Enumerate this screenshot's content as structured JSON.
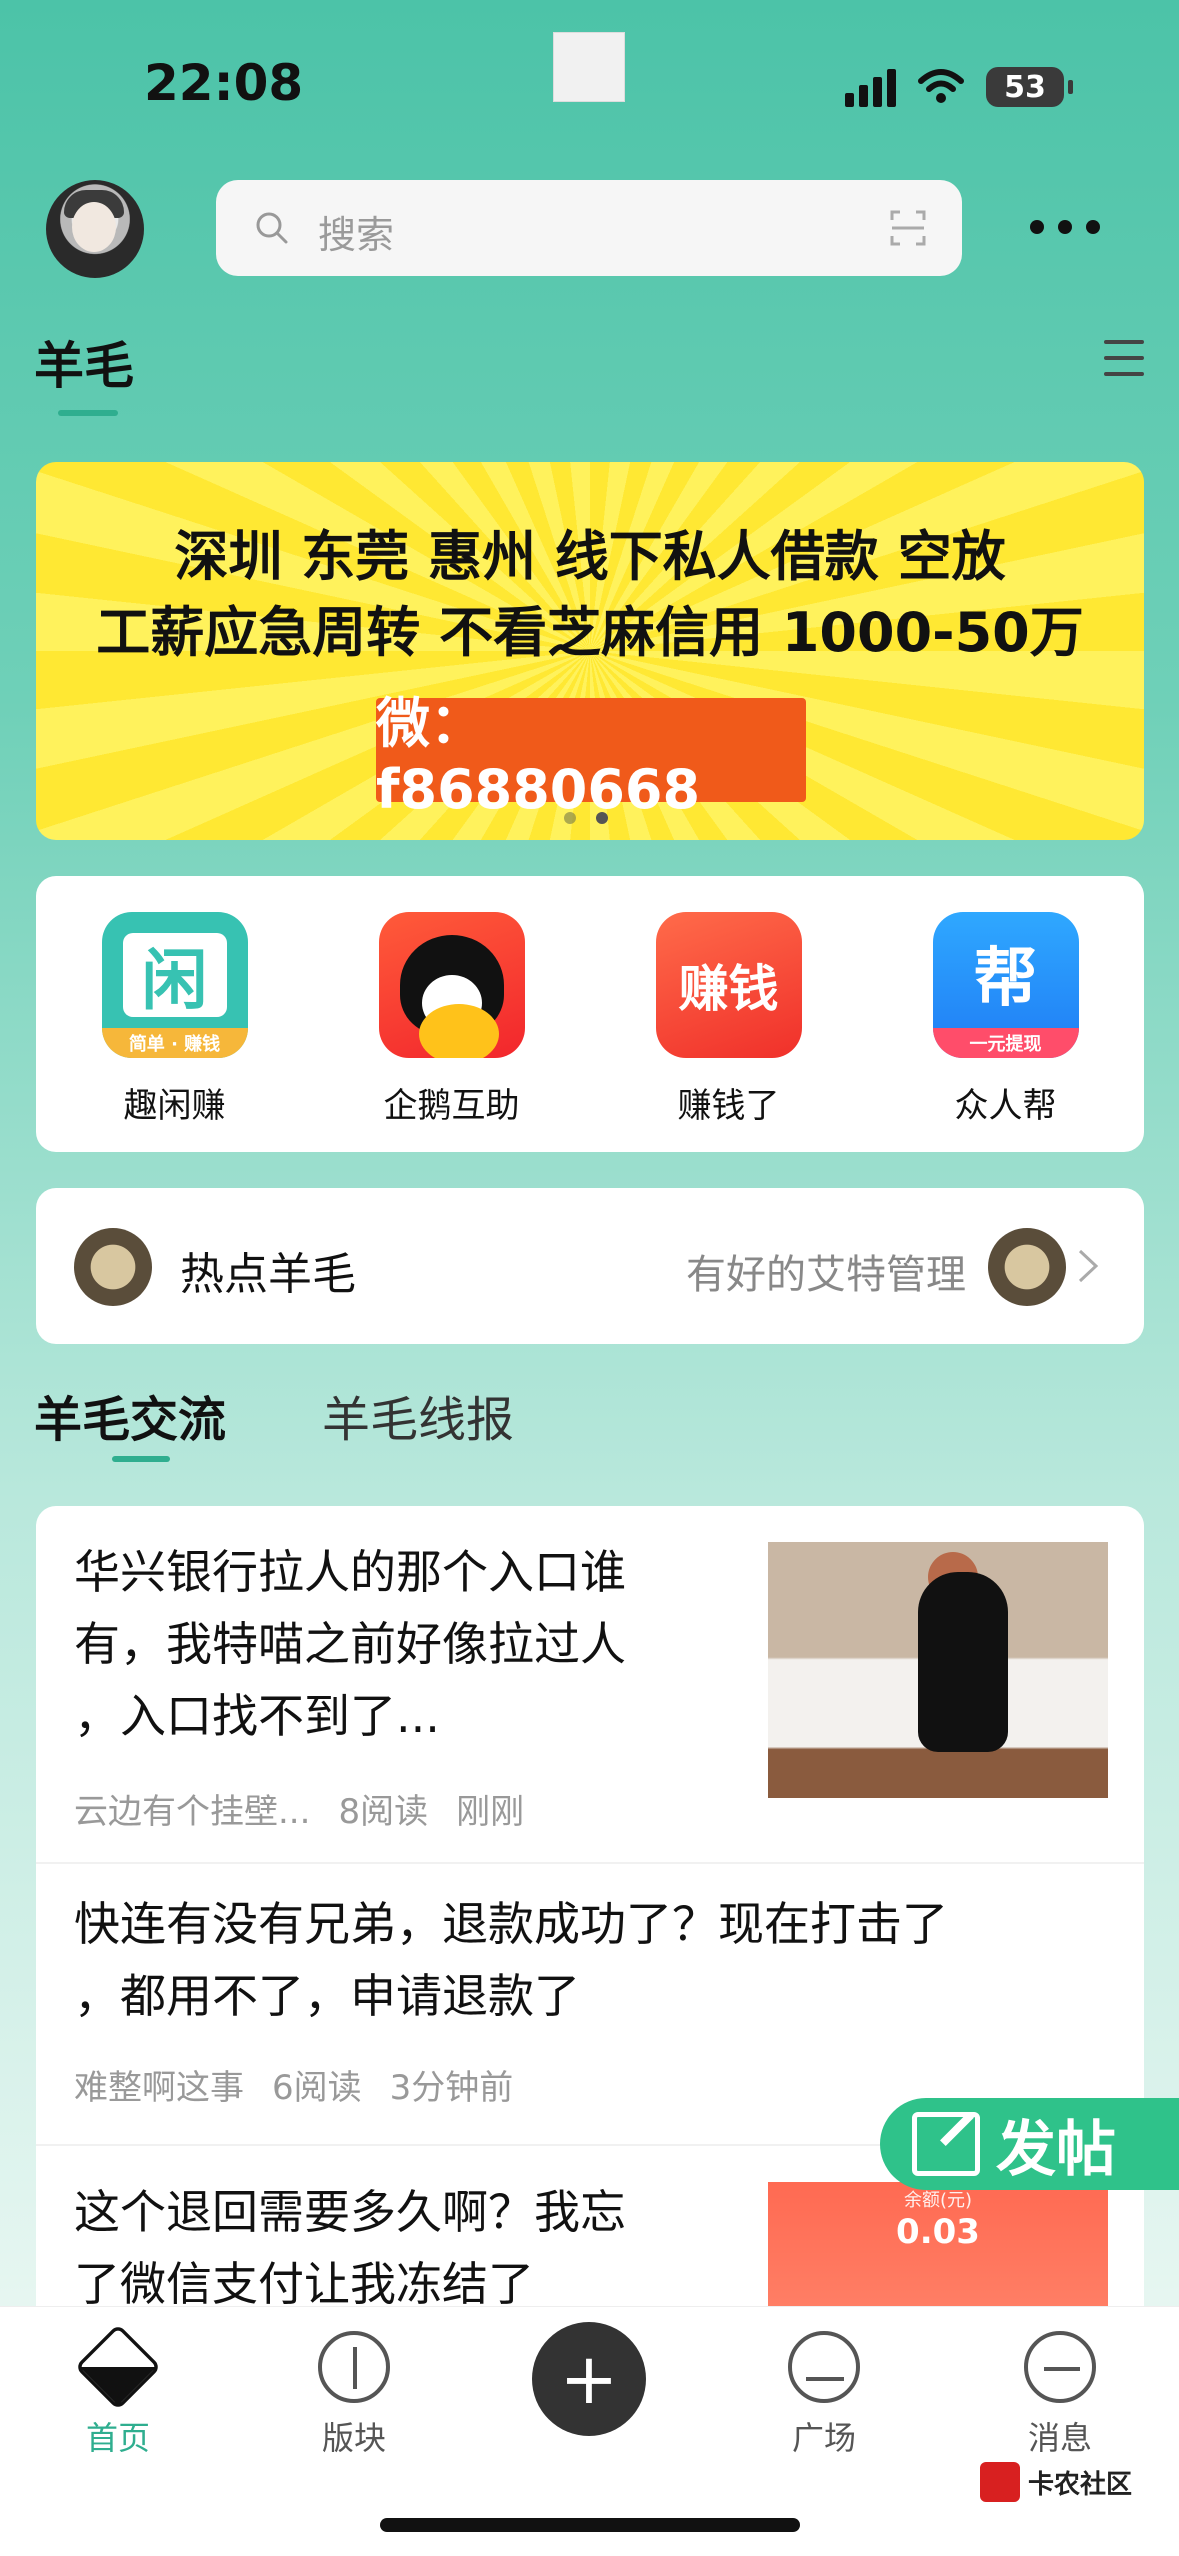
{
  "status_bar": {
    "time": "22:08",
    "battery": "53"
  },
  "header": {
    "search_placeholder": "搜索"
  },
  "section": {
    "title": "羊毛"
  },
  "banner": {
    "line1": "深圳 东莞 惠州  线下私人借款 空放",
    "line2": "工薪应急周转  不看芝麻信用   1000-50万",
    "contact": "微：f86880668"
  },
  "apps": [
    {
      "label": "趣闲赚",
      "icon_text": "闲",
      "badge": "简单 · 赚钱"
    },
    {
      "label": "企鹅互助"
    },
    {
      "label": "赚钱了",
      "icon_text": "赚钱"
    },
    {
      "label": "众人帮",
      "icon_text": "帮",
      "badge": "一元提现"
    }
  ],
  "hot": {
    "title": "热点羊毛",
    "subtitle": "有好的艾特管理"
  },
  "tabs": [
    {
      "label": "羊毛交流"
    },
    {
      "label": "羊毛线报"
    }
  ],
  "posts": [
    {
      "title_lines": [
        "华兴银行拉人的那个入口谁",
        "有，我特喵之前好像拉过人",
        "，入口找不到了..."
      ],
      "author": "云边有个挂壁...",
      "reads": "8阅读",
      "time": "刚刚"
    },
    {
      "title_lines": [
        "快连有没有兄弟，退款成功了？现在打击了",
        "，都用不了，申请退款了"
      ],
      "author": "难整啊这事",
      "reads": "6阅读",
      "time": "3分钟前"
    },
    {
      "title_lines": [
        "这个退回需要多久啊？我忘",
        "了微信支付让我冻结了"
      ],
      "thumb_label": "余额(元)",
      "thumb_value": "0.03"
    }
  ],
  "fab": {
    "label": "发帖"
  },
  "bottom_nav": [
    {
      "label": "首页"
    },
    {
      "label": "版块"
    },
    {
      "label": "广场"
    },
    {
      "label": "消息"
    }
  ],
  "watermark": {
    "text": "卡农社区"
  },
  "colors": {
    "accent": "#2fae8f",
    "banner_bg": "#ffe833",
    "banner_contact": "#f05a1a",
    "fab_post": "#2fc28a"
  }
}
